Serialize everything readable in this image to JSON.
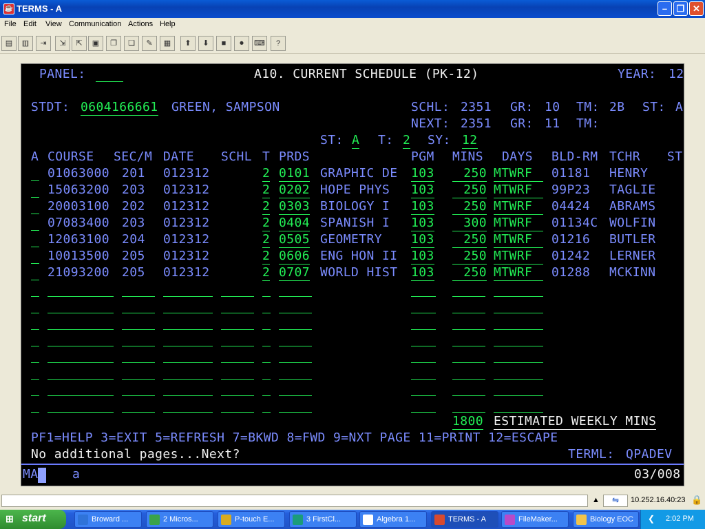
{
  "window": {
    "title": "TERMS - A"
  },
  "menu": [
    "File",
    "Edit",
    "View",
    "Communication",
    "Actions",
    "Help"
  ],
  "toolbar_icons": [
    "print-icon",
    "copy-screen-icon",
    "paste-icon",
    "disconnect-icon",
    "reconnect-icon",
    "macro-icon",
    "copy-icon",
    "paste-icon",
    "color-icon",
    "grid-icon",
    "send-icon",
    "receive-icon",
    "stop-icon",
    "record-icon",
    "keyboard-icon",
    "help-icon"
  ],
  "terminal": {
    "header": {
      "panel_label": "PANEL:",
      "screen_title": "A10. CURRENT SCHEDULE (PK-12)",
      "year_label": "YEAR:",
      "year_value": "12"
    },
    "student": {
      "stdt_label": "STDT:",
      "stdt_id": "0604166661",
      "stdt_name": "GREEN, SAMPSON",
      "schl_label": "SCHL:",
      "schl_value": "2351",
      "gr_label": "GR:",
      "gr_value": "10",
      "tm_label": "TM:",
      "tm_value": "2B",
      "st_label": "ST:",
      "st_value": "A"
    },
    "next": {
      "next_label": "NEXT:",
      "next_schl": "2351",
      "gr_label": "GR:",
      "gr_value": "11",
      "tm_label": "TM:"
    },
    "status_line": {
      "st_label": "ST:",
      "st_value": "A",
      "t_label": "T:",
      "t_value": "2",
      "sy_label": "SY:",
      "sy_value": "12"
    },
    "columns": {
      "a": "A",
      "course": "COURSE",
      "secm": "SEC/M",
      "date": "DATE",
      "schl": "SCHL",
      "t": "T",
      "prds": "PRDS",
      "pgm": "PGM",
      "mins": "MINS",
      "days": "DAYS",
      "bldrm": "BLD-RM",
      "tchr": "TCHR",
      "st": "ST"
    },
    "rows": [
      {
        "course": "01063000",
        "sec": "201",
        "date": "012312",
        "t": "2",
        "prds": "0101",
        "title": "GRAPHIC DE",
        "pgm": "103",
        "mins": "250",
        "days": "MTWRF",
        "bldrm": "01181",
        "tchr": "HENRY"
      },
      {
        "course": "15063200",
        "sec": "203",
        "date": "012312",
        "t": "2",
        "prds": "0202",
        "title": "HOPE PHYS",
        "pgm": "103",
        "mins": "250",
        "days": "MTWRF",
        "bldrm": "99P23",
        "tchr": "TAGLIE"
      },
      {
        "course": "20003100",
        "sec": "202",
        "date": "012312",
        "t": "2",
        "prds": "0303",
        "title": "BIOLOGY I",
        "pgm": "103",
        "mins": "250",
        "days": "MTWRF",
        "bldrm": "04424",
        "tchr": "ABRAMS"
      },
      {
        "course": "07083400",
        "sec": "203",
        "date": "012312",
        "t": "2",
        "prds": "0404",
        "title": "SPANISH I",
        "pgm": "103",
        "mins": "300",
        "days": "MTWRF",
        "bldrm": "01134C",
        "tchr": "WOLFIN"
      },
      {
        "course": "12063100",
        "sec": "204",
        "date": "012312",
        "t": "2",
        "prds": "0505",
        "title": "GEOMETRY",
        "pgm": "103",
        "mins": "250",
        "days": "MTWRF",
        "bldrm": "01216",
        "tchr": "BUTLER"
      },
      {
        "course": "10013500",
        "sec": "205",
        "date": "012312",
        "t": "2",
        "prds": "0606",
        "title": "ENG HON II",
        "pgm": "103",
        "mins": "250",
        "days": "MTWRF",
        "bldrm": "01242",
        "tchr": "LERNER"
      },
      {
        "course": "21093200",
        "sec": "205",
        "date": "012312",
        "t": "2",
        "prds": "0707",
        "title": "WORLD HIST",
        "pgm": "103",
        "mins": "250",
        "days": "MTWRF",
        "bldrm": "01288",
        "tchr": "MCKINN"
      }
    ],
    "total_mins": "1800",
    "total_label": "ESTIMATED WEEKLY MINS",
    "pf_keys": "PF1=HELP 3=EXIT 5=REFRESH 7=BKWD 8=FWD 9=NXT PAGE 11=PRINT 12=ESCAPE",
    "message": "No additional pages...Next?",
    "terml_label": "TERML:",
    "terml_value": "QPADEV",
    "oia_left": "MA",
    "oia_input": "a",
    "oia_pos": "03/008"
  },
  "statusbar": {
    "ip": "10.252.16.40:23"
  },
  "taskbar": {
    "start": "start",
    "tasks": [
      "Broward ...",
      "2 Micros...",
      "P-touch E...",
      "3 FirstCl...",
      "Algebra 1...",
      "TERMS - A",
      "FileMaker...",
      "Biology EOC"
    ],
    "clock": "2:02 PM"
  },
  "colors": {
    "term_bg": "#000000",
    "field_green": "#22ee55",
    "label_blue": "#7b8cff",
    "text_white": "#f0f0f0"
  }
}
